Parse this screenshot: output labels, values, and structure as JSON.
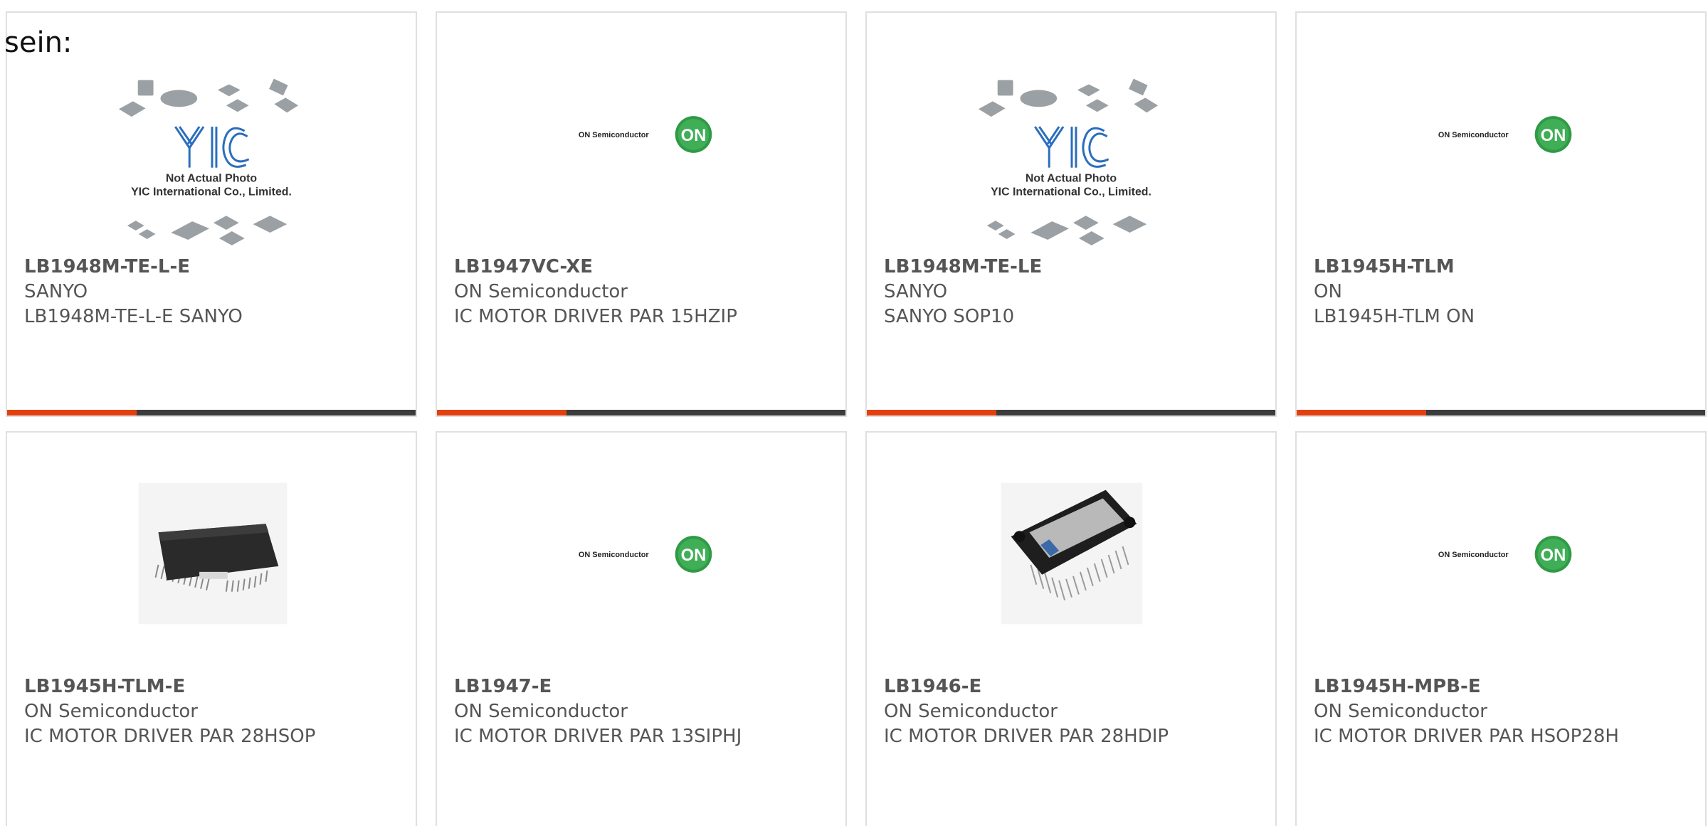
{
  "intro_text": "sein:",
  "colors": {
    "accent": "#e3400f",
    "bar": "#3c3c3c",
    "on_green": "#2f9a46",
    "yic_blue": "#2a6ebd"
  },
  "products": [
    {
      "part": "LB1948M-TE-L-E",
      "maker": "SANYO",
      "desc": "LB1948M-TE-L-E SANYO",
      "image": "yic-not-actual-photo",
      "image_caption_1": "Not Actual Photo",
      "image_caption_2": "YIC International Co., Limited.",
      "logo_text": "YIC"
    },
    {
      "part": "LB1947VC-XE",
      "maker": "ON Semiconductor",
      "desc": "IC MOTOR DRIVER PAR 15HZIP",
      "image": "on-semiconductor-logo",
      "logo_word": "ON Semiconductor",
      "logo_badge": "ON"
    },
    {
      "part": "LB1948M-TE-LE",
      "maker": "SANYO",
      "desc": "SANYO SOP10",
      "image": "yic-not-actual-photo",
      "image_caption_1": "Not Actual Photo",
      "image_caption_2": "YIC International Co., Limited.",
      "logo_text": "YIC"
    },
    {
      "part": "LB1945H-TLM",
      "maker": "ON",
      "desc": "LB1945H-TLM ON",
      "image": "on-semiconductor-logo",
      "logo_word": "ON Semiconductor",
      "logo_badge": "ON"
    },
    {
      "part": "LB1945H-TLM-E",
      "maker": "ON Semiconductor",
      "desc": "IC MOTOR DRIVER PAR 28HSOP",
      "image": "hsop-chip-photo"
    },
    {
      "part": "LB1947-E",
      "maker": "ON Semiconductor",
      "desc": "IC MOTOR DRIVER PAR 13SIPHJ",
      "image": "on-semiconductor-logo",
      "logo_word": "ON Semiconductor",
      "logo_badge": "ON"
    },
    {
      "part": "LB1946-E",
      "maker": "ON Semiconductor",
      "desc": "IC MOTOR DRIVER PAR 28HDIP",
      "image": "hdip-chip-photo"
    },
    {
      "part": "LB1945H-MPB-E",
      "maker": "ON Semiconductor",
      "desc": "IC MOTOR DRIVER PAR HSOP28H",
      "image": "on-semiconductor-logo",
      "logo_word": "ON Semiconductor",
      "logo_badge": "ON"
    }
  ]
}
